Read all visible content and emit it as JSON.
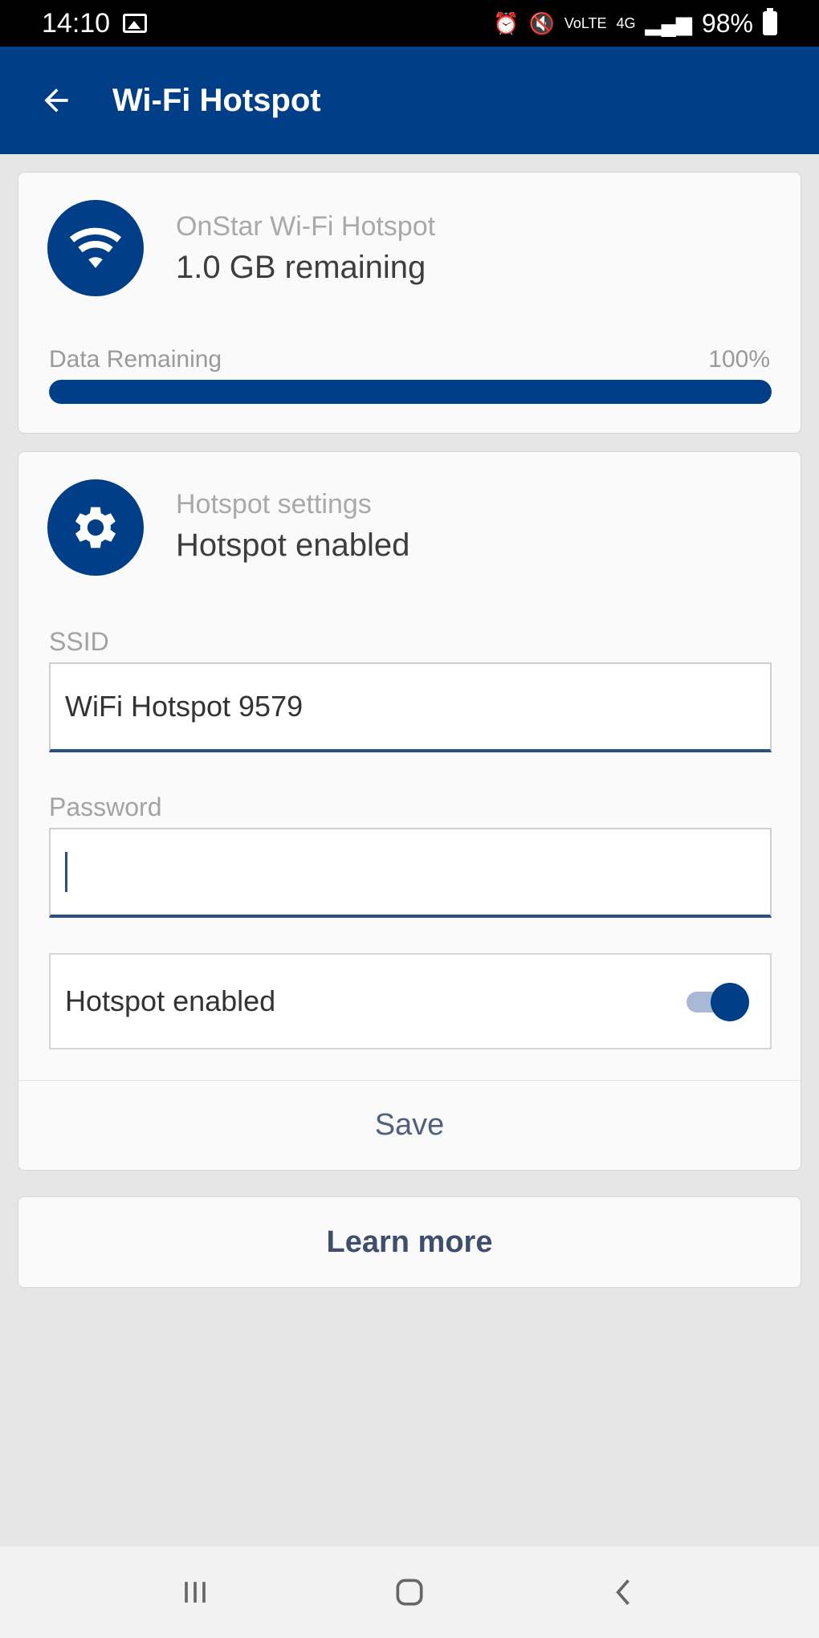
{
  "status_bar": {
    "time": "14:10",
    "battery": "98%"
  },
  "app_bar": {
    "title": "Wi-Fi Hotspot"
  },
  "data_card": {
    "subtitle": "OnStar Wi-Fi Hotspot",
    "title": "1.0 GB remaining",
    "progress_label": "Data Remaining",
    "progress_percent_text": "100%",
    "progress_value": 1.0
  },
  "settings_card": {
    "subtitle": "Hotspot settings",
    "title": "Hotspot enabled",
    "ssid_label": "SSID",
    "ssid_value": "WiFi Hotspot 9579",
    "password_label": "Password",
    "password_value": "",
    "toggle_label": "Hotspot enabled",
    "toggle_on": true,
    "save_label": "Save"
  },
  "learn_more": {
    "label": "Learn more"
  },
  "colors": {
    "brand": "#003f87",
    "background": "#e6e6e6",
    "card": "#fafafa"
  },
  "icons": {
    "wifi": "wifi-icon",
    "settings": "gear-icon",
    "back": "arrow-left-icon"
  }
}
